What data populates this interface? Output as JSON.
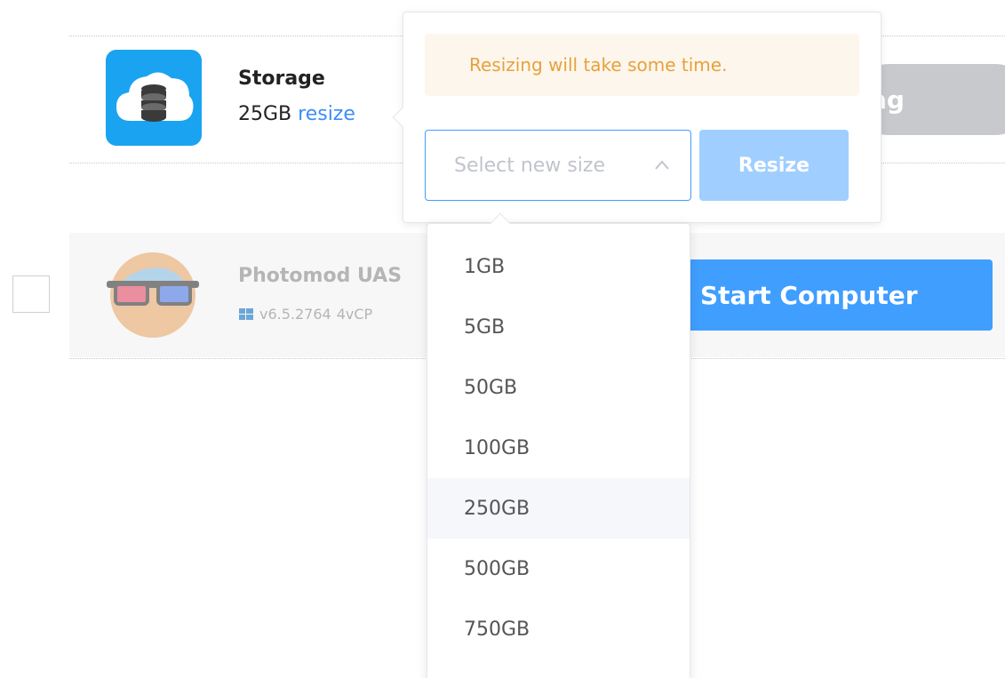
{
  "storage": {
    "title": "Storage",
    "size": "25GB",
    "resize_link": "resize",
    "icon": "cloud-database-icon",
    "icon_color": "#1aa3f0"
  },
  "background_button": {
    "visible_label": "ng"
  },
  "photomod": {
    "title": "Photomod UAS",
    "version": "v6.5.2764",
    "cpu": "4vCP",
    "os_icon": "windows-icon",
    "start_button": "Start Computer"
  },
  "popover": {
    "warning": "Resizing will take some time.",
    "select_placeholder": "Select new size",
    "resize_button": "Resize",
    "colors": {
      "warning_bg": "#fdf6ec",
      "warning_text": "#e6a23c",
      "primary": "#409eff",
      "primary_disabled": "#a0cfff"
    }
  },
  "dropdown": {
    "options": [
      "1GB",
      "5GB",
      "50GB",
      "100GB",
      "250GB",
      "500GB",
      "750GB"
    ],
    "hovered_option": "250GB"
  }
}
